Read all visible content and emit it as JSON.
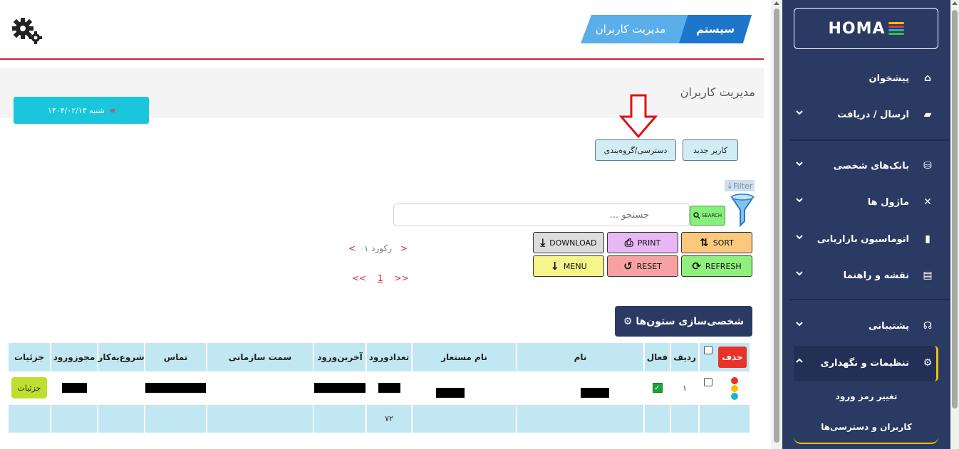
{
  "header": {
    "breadcrumb": {
      "parent": "سیستم",
      "current": "مدیریت کاربران"
    },
    "settings_icon": "gear-icon"
  },
  "page": {
    "title": "مدیریت کاربران",
    "date": "شنبه ۱۴۰۴/۰۲/۱۳"
  },
  "toolbar": {
    "new_user": "کاربر جدید",
    "access_group": "دسترسی/گروه‌بندی",
    "filter": "Filter",
    "search_placeholder": "جستجو ...",
    "search_button": "SEARCH",
    "sort": "SORT",
    "print": "PRINT",
    "download": "DOWNLOAD",
    "refresh": "REFRESH",
    "reset": "RESET",
    "menu": "MENU"
  },
  "pager": {
    "record_count": "۱ رکورد",
    "prev": "<",
    "next": ">",
    "first": "<<",
    "last": ">>",
    "current_page": "1"
  },
  "columns_button": "⚙ شخصی‌سازی ستون‌ها",
  "table": {
    "headers": {
      "delete": "حذف",
      "row": "ردیف",
      "active": "فعال",
      "name": "نام",
      "username": "نام مستعار",
      "login_count": "تعدادورود",
      "last_login": "آخرین‌ورود",
      "position": "سمت سازمانی",
      "contact": "تماس",
      "start": "شروع‌به‌کار",
      "permit": "مجوزورود",
      "details": "جزئیات"
    },
    "rows": [
      {
        "row": "۱",
        "active": true,
        "details": "جزئیات"
      }
    ],
    "footer": {
      "login_total": "۷۲"
    }
  },
  "sidebar": {
    "logo": "HOMA",
    "items": [
      {
        "label": "پیشخوان",
        "icon": "home-icon"
      },
      {
        "label": "ارسال / دریافت",
        "icon": "message-icon"
      },
      {
        "label": "بانک‌های شخصی",
        "icon": "database-icon"
      },
      {
        "label": "ماژول ها",
        "icon": "tools-icon"
      },
      {
        "label": "اتوماسیون بازاریابی",
        "icon": "chart-icon"
      },
      {
        "label": "نقشه و راهنما",
        "icon": "map-icon"
      },
      {
        "label": "پشتیبانی",
        "icon": "headset-icon"
      },
      {
        "label": "تنظیمات و نگهداری",
        "icon": "gear-icon"
      }
    ],
    "sub_items": [
      "تغییر رمز ورود",
      "کاربران و دسترسی‌ها"
    ]
  }
}
